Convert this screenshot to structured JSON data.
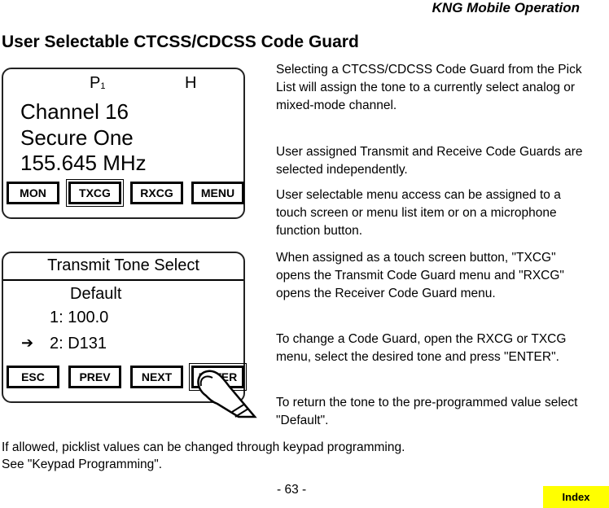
{
  "header": {
    "running_title": "KNG Mobile Operation"
  },
  "page_title": "User Selectable CTCSS/CDCSS Code Guard",
  "screen1": {
    "status_profile": "P",
    "status_profile_sub": "1",
    "status_power": "H",
    "lines": [
      "Channel 16",
      "Secure One",
      "155.645 MHz"
    ],
    "softkeys": [
      {
        "label": "MON",
        "selected": false
      },
      {
        "label": "TXCG",
        "selected": true
      },
      {
        "label": "RXCG",
        "selected": false
      },
      {
        "label": "MENU",
        "selected": false
      }
    ]
  },
  "screen2": {
    "title": "Transmit Tone Select",
    "options": [
      "Default",
      "1: 100.0",
      "2: D131"
    ],
    "selected_index": 2,
    "selector_icon": "right-arrow-icon",
    "softkeys": [
      {
        "label": "ESC"
      },
      {
        "label": "PREV"
      },
      {
        "label": "NEXT"
      },
      {
        "label": "ENTER"
      }
    ],
    "pressed_key": "ENTER"
  },
  "paragraphs": [
    "Selecting a CTCSS/CDCSS Code Guard from the Pick List will assign the tone to a currently select analog or mixed-mode channel.",
    "User assigned Transmit and Receive Code Guards are selected independently.",
    "User selectable menu access can be assigned to a touch screen or menu list item or on a microphone function button.",
    " When assigned as a touch screen button, \"TXCG\" opens the Transmit Code Guard menu and \"RXCG\" opens the Receiver Code Guard menu.",
    "To change a Code Guard, open the RXCG or TXCG menu, select the desired tone and press \"ENTER\".",
    "To return the tone to the pre-programmed value select \"Default\"."
  ],
  "footnote": {
    "line1": "If allowed, picklist values can be changed through keypad programming.",
    "line2": "See \"Keypad Programming\"."
  },
  "page_number": "- 63 -",
  "index_button": {
    "label": "Index",
    "color": "#ffff00"
  }
}
